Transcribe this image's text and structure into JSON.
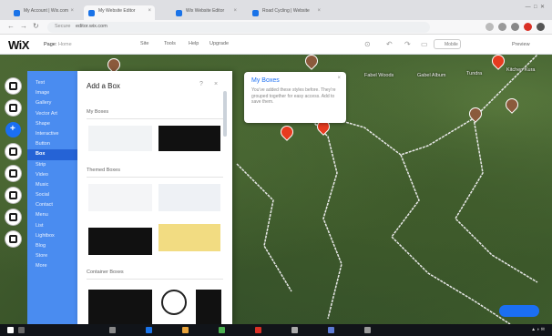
{
  "browser": {
    "tabs": [
      {
        "label": "My Account | Wix.com",
        "active": false
      },
      {
        "label": "My Website Editor",
        "active": true
      },
      {
        "label": "Wix Website Editor",
        "active": false
      },
      {
        "label": "Road Cycling | Website",
        "active": false
      }
    ],
    "url": "editor.wix.com",
    "url_prefix": "Secure"
  },
  "wix": {
    "logo": "WiX",
    "page_label": "Page:",
    "page_value": "Home",
    "menu": [
      "Site",
      "Tools",
      "Help",
      "Upgrade"
    ],
    "mobile_label": "Mobile",
    "preview_label": "Preview"
  },
  "categories": [
    "Text",
    "Image",
    "Gallery",
    "Vector Art",
    "Shape",
    "Interactive",
    "Button",
    "Box",
    "Strip",
    "Video",
    "Music",
    "Social",
    "Contact",
    "Menu",
    "List",
    "Lightbox",
    "Blog",
    "Store",
    "More"
  ],
  "selected_category": "Box",
  "add_panel": {
    "title": "Add a Box",
    "sections": [
      "My Boxes",
      "Themed Boxes",
      "Container Boxes"
    ]
  },
  "tooltip": {
    "title": "My Boxes",
    "body": "You've added these styles before. They're grouped together for easy access. Add to save them."
  },
  "map_labels": [
    "Fabel Woods",
    "Gabel Album",
    "Tundra",
    "Kitchen Kura"
  ],
  "colors": {
    "wix_blue": "#1b6ff2",
    "category_bg": "#4a8cf0",
    "pin_red": "#e63b1f",
    "swatch_black": "#111111",
    "swatch_yellow": "#f2dc82"
  }
}
